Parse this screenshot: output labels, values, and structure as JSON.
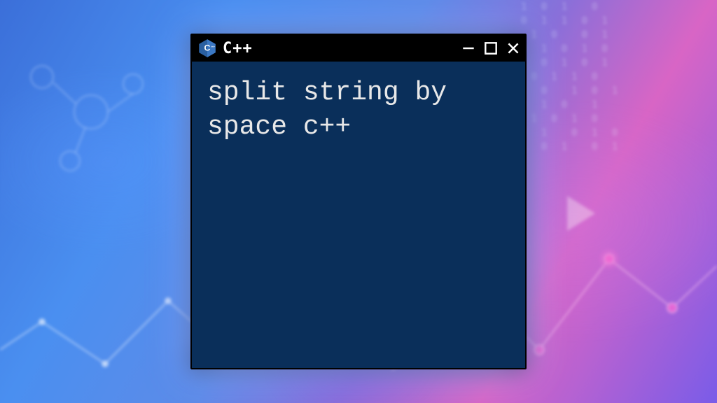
{
  "window": {
    "title": "C++",
    "code_text": "split string by space c++"
  }
}
